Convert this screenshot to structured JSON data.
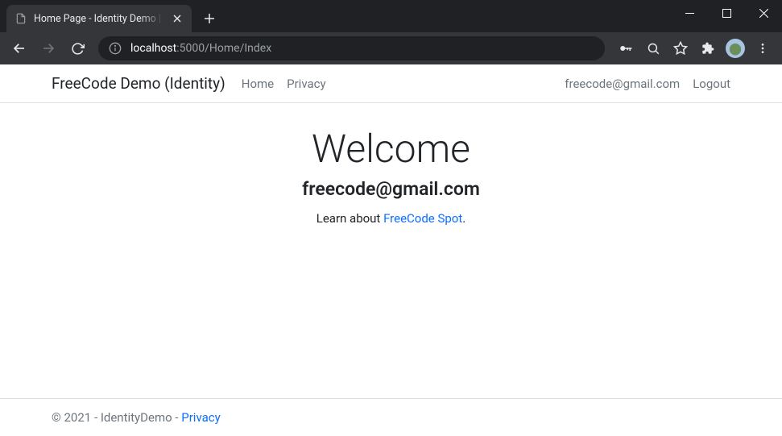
{
  "browser": {
    "tab_title": "Home Page - Identity Demo | FreeCode",
    "url_host": "localhost",
    "url_port_path": ":5000/Home/Index"
  },
  "nav": {
    "brand": "FreeCode Demo (Identity)",
    "links": [
      "Home",
      "Privacy"
    ],
    "user_email": "freecode@gmail.com",
    "logout": "Logout"
  },
  "main": {
    "heading": "Welcome",
    "subheading": "freecode@gmail.com",
    "learn_prefix": "Learn about ",
    "learn_link": "FreeCode Spot",
    "learn_suffix": "."
  },
  "footer": {
    "text": "© 2021 - IdentityDemo - ",
    "privacy_link": "Privacy"
  }
}
